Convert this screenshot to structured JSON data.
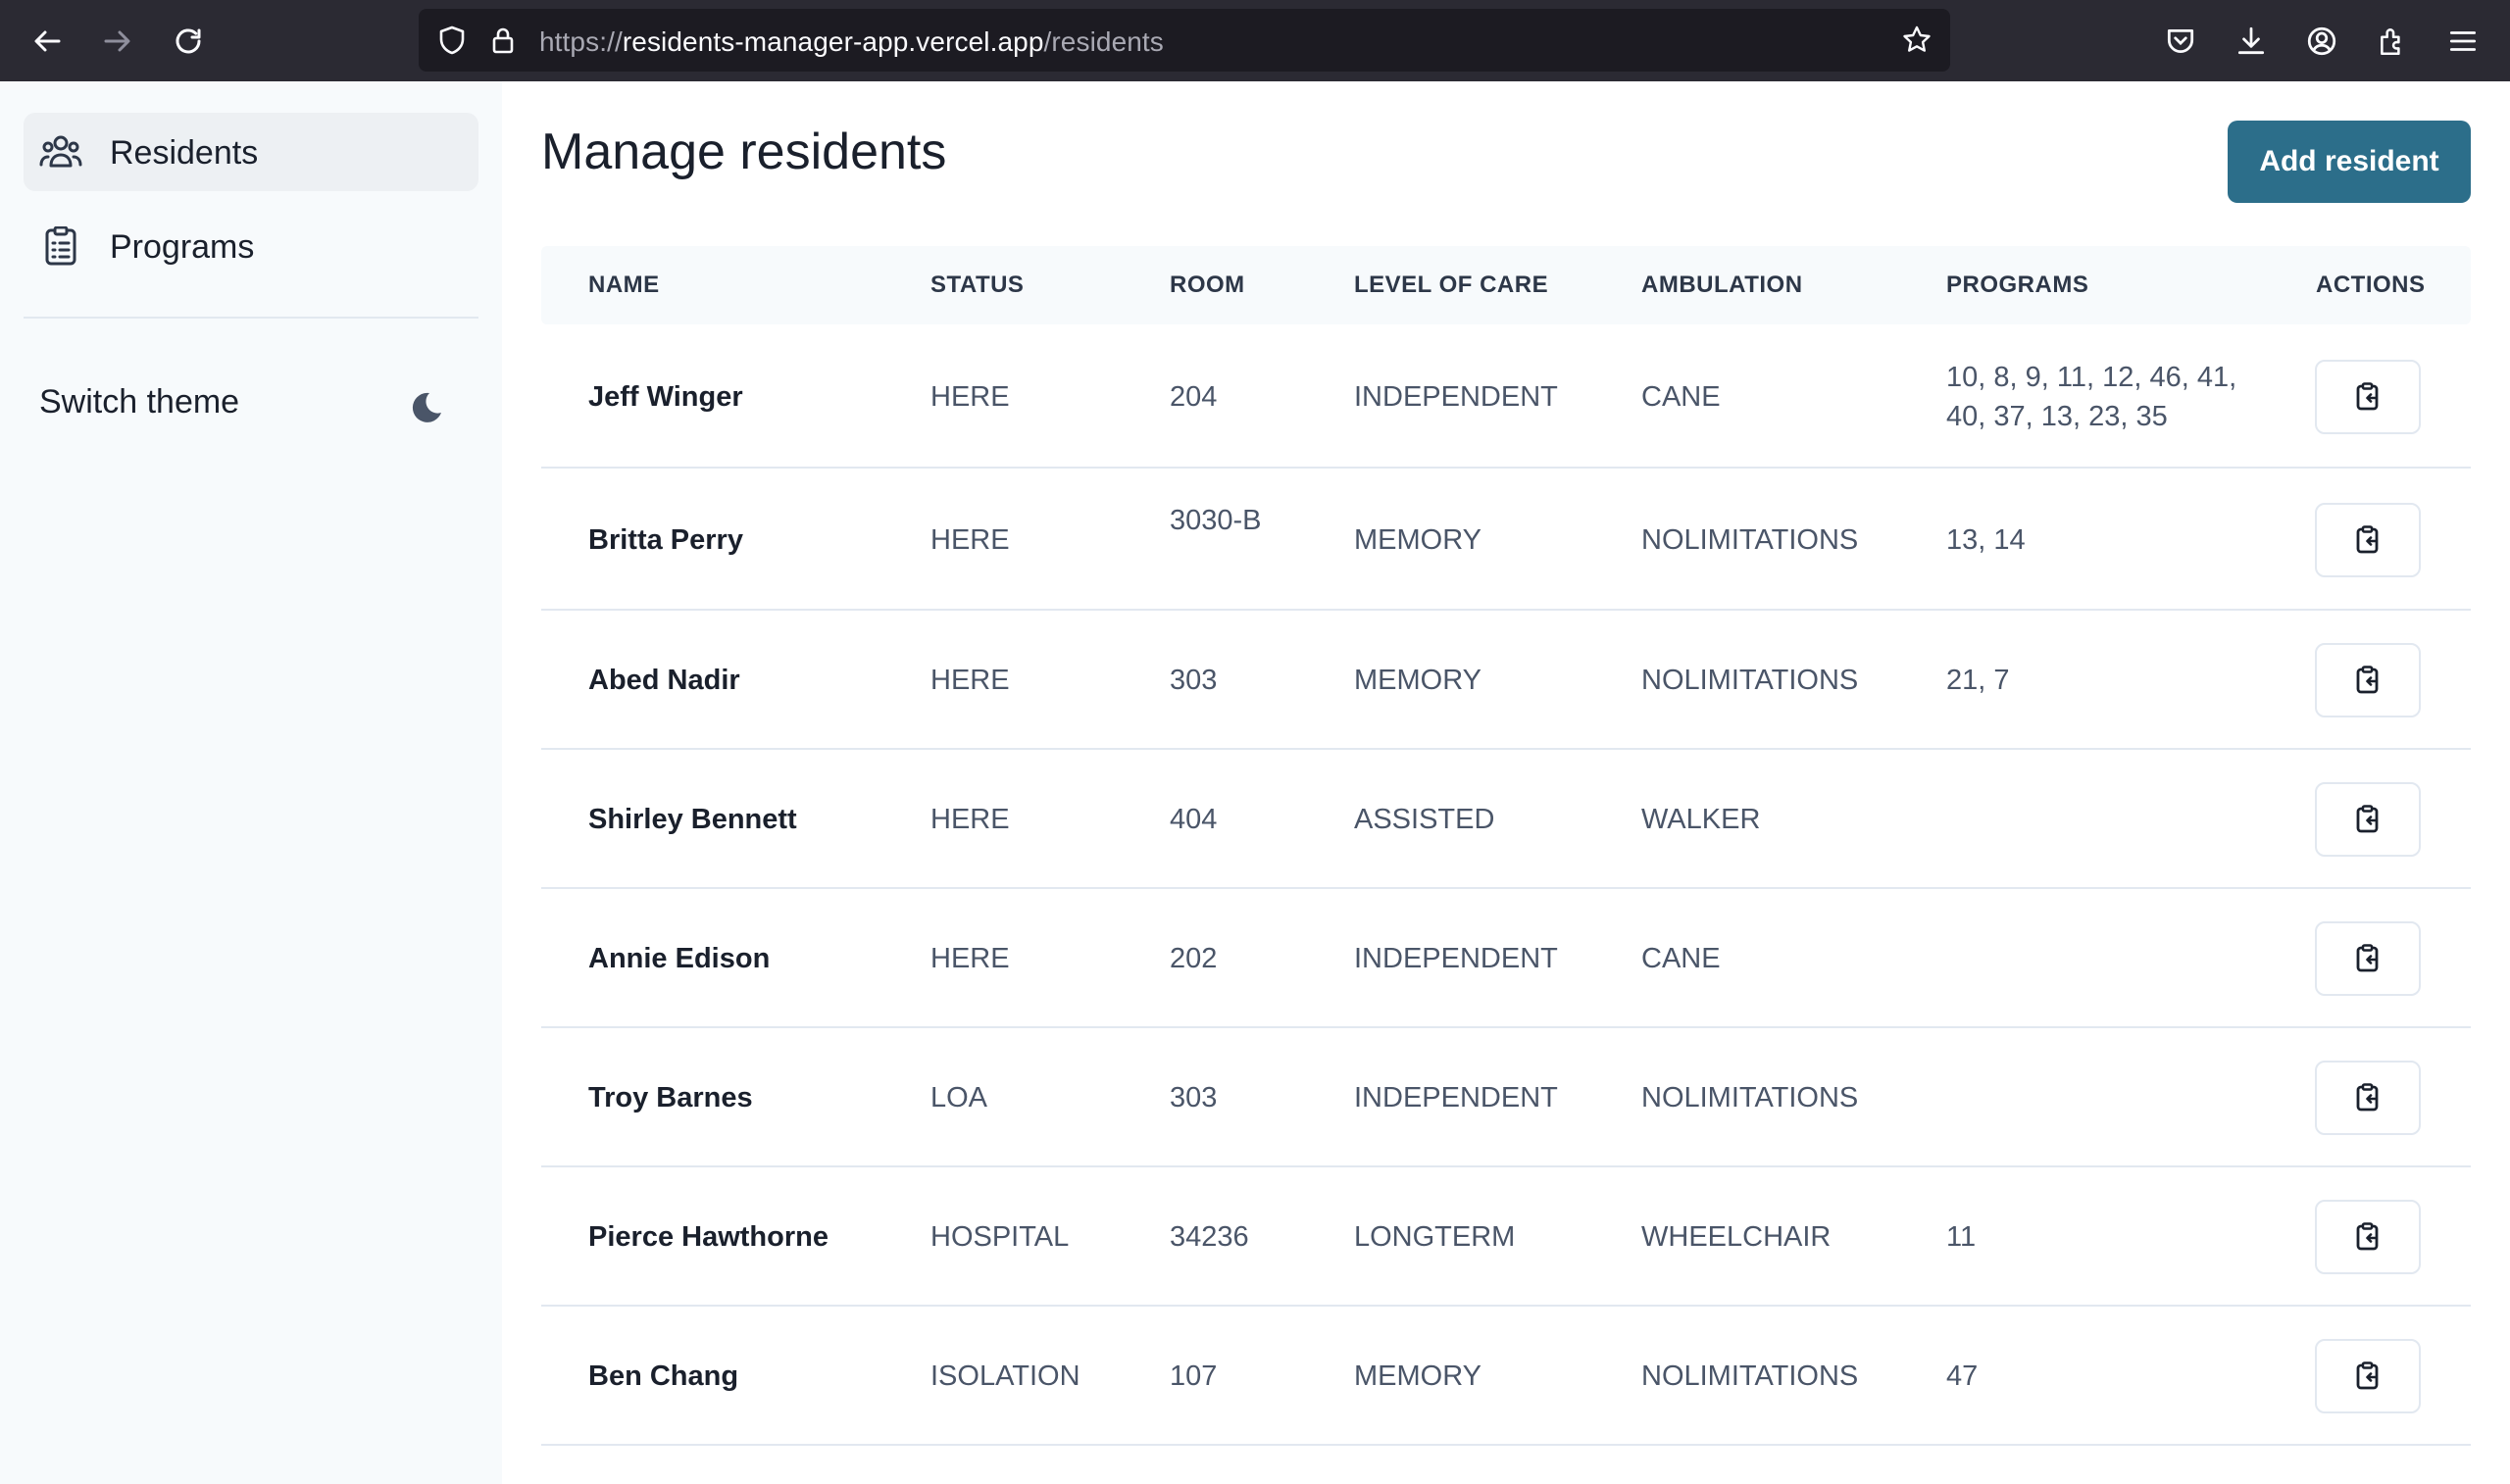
{
  "browser": {
    "url_scheme": "https://",
    "url_host": "residents-manager-app.vercel.app",
    "url_path": "/residents"
  },
  "sidebar": {
    "items": [
      {
        "label": "Residents",
        "icon": "users-icon",
        "active": true
      },
      {
        "label": "Programs",
        "icon": "clipboard-list-icon",
        "active": false
      }
    ],
    "theme_label": "Switch theme",
    "theme_icon": "moon-icon"
  },
  "main": {
    "title": "Manage residents",
    "add_button": "Add resident",
    "columns": [
      "NAME",
      "STATUS",
      "ROOM",
      "LEVEL OF CARE",
      "AMBULATION",
      "PROGRAMS",
      "ACTIONS"
    ],
    "rows": [
      {
        "name": "Jeff Winger",
        "status": "HERE",
        "room": "204",
        "level": "INDEPENDENT",
        "ambulation": "CANE",
        "programs": "10, 8, 9, 11, 12, 46, 41, 40, 37, 13, 23, 35"
      },
      {
        "name": "Britta Perry",
        "status": "HERE",
        "room": "3030-B",
        "level": "MEMORY",
        "ambulation": "NOLIMITATIONS",
        "programs": "13, 14"
      },
      {
        "name": "Abed Nadir",
        "status": "HERE",
        "room": "303",
        "level": "MEMORY",
        "ambulation": "NOLIMITATIONS",
        "programs": "21, 7"
      },
      {
        "name": "Shirley Bennett",
        "status": "HERE",
        "room": "404",
        "level": "ASSISTED",
        "ambulation": "WALKER",
        "programs": ""
      },
      {
        "name": "Annie Edison",
        "status": "HERE",
        "room": "202",
        "level": "INDEPENDENT",
        "ambulation": "CANE",
        "programs": ""
      },
      {
        "name": "Troy Barnes",
        "status": "LOA",
        "room": "303",
        "level": "INDEPENDENT",
        "ambulation": "NOLIMITATIONS",
        "programs": ""
      },
      {
        "name": "Pierce Hawthorne",
        "status": "HOSPITAL",
        "room": "34236",
        "level": "LONGTERM",
        "ambulation": "WHEELCHAIR",
        "programs": "11"
      },
      {
        "name": "Ben Chang",
        "status": "ISOLATION",
        "room": "107",
        "level": "MEMORY",
        "ambulation": "NOLIMITATIONS",
        "programs": "47"
      }
    ],
    "action_icon": "clipboard-copy-icon"
  }
}
